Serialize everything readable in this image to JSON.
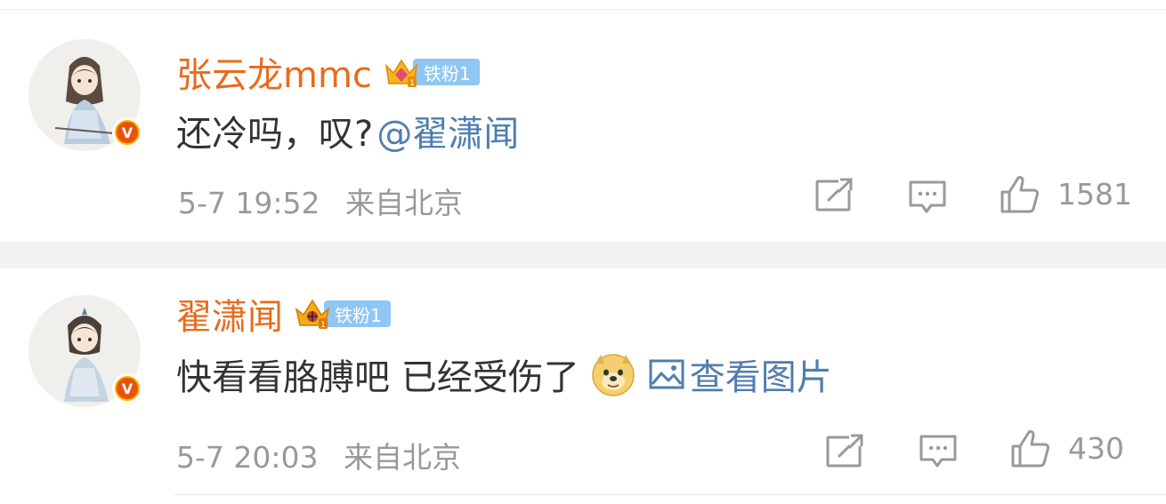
{
  "comments": [
    {
      "username": "张云龙mmc",
      "fan_badge": "铁粉1",
      "verified_badge": "V",
      "text": "还冷吗，叹?",
      "mention": "@翟潇闻",
      "time": "5-7 19:52",
      "source": "来自北京",
      "likes": "1581"
    },
    {
      "username": "翟潇闻",
      "fan_badge": "铁粉1",
      "verified_badge": "V",
      "text": "快看看胳膊吧 已经受伤了",
      "image_link": "查看图片",
      "time": "5-7 20:03",
      "source": "来自北京",
      "likes": "430"
    }
  ],
  "icons": [
    "repost-icon",
    "comment-icon",
    "like-icon",
    "crown-icon",
    "doge-emoji",
    "image-icon"
  ],
  "colors": {
    "username": "#e86b1c",
    "link": "#507daf",
    "meta": "#999999",
    "fan_badge": "#8fc6f3",
    "verified": "#e8520f"
  }
}
